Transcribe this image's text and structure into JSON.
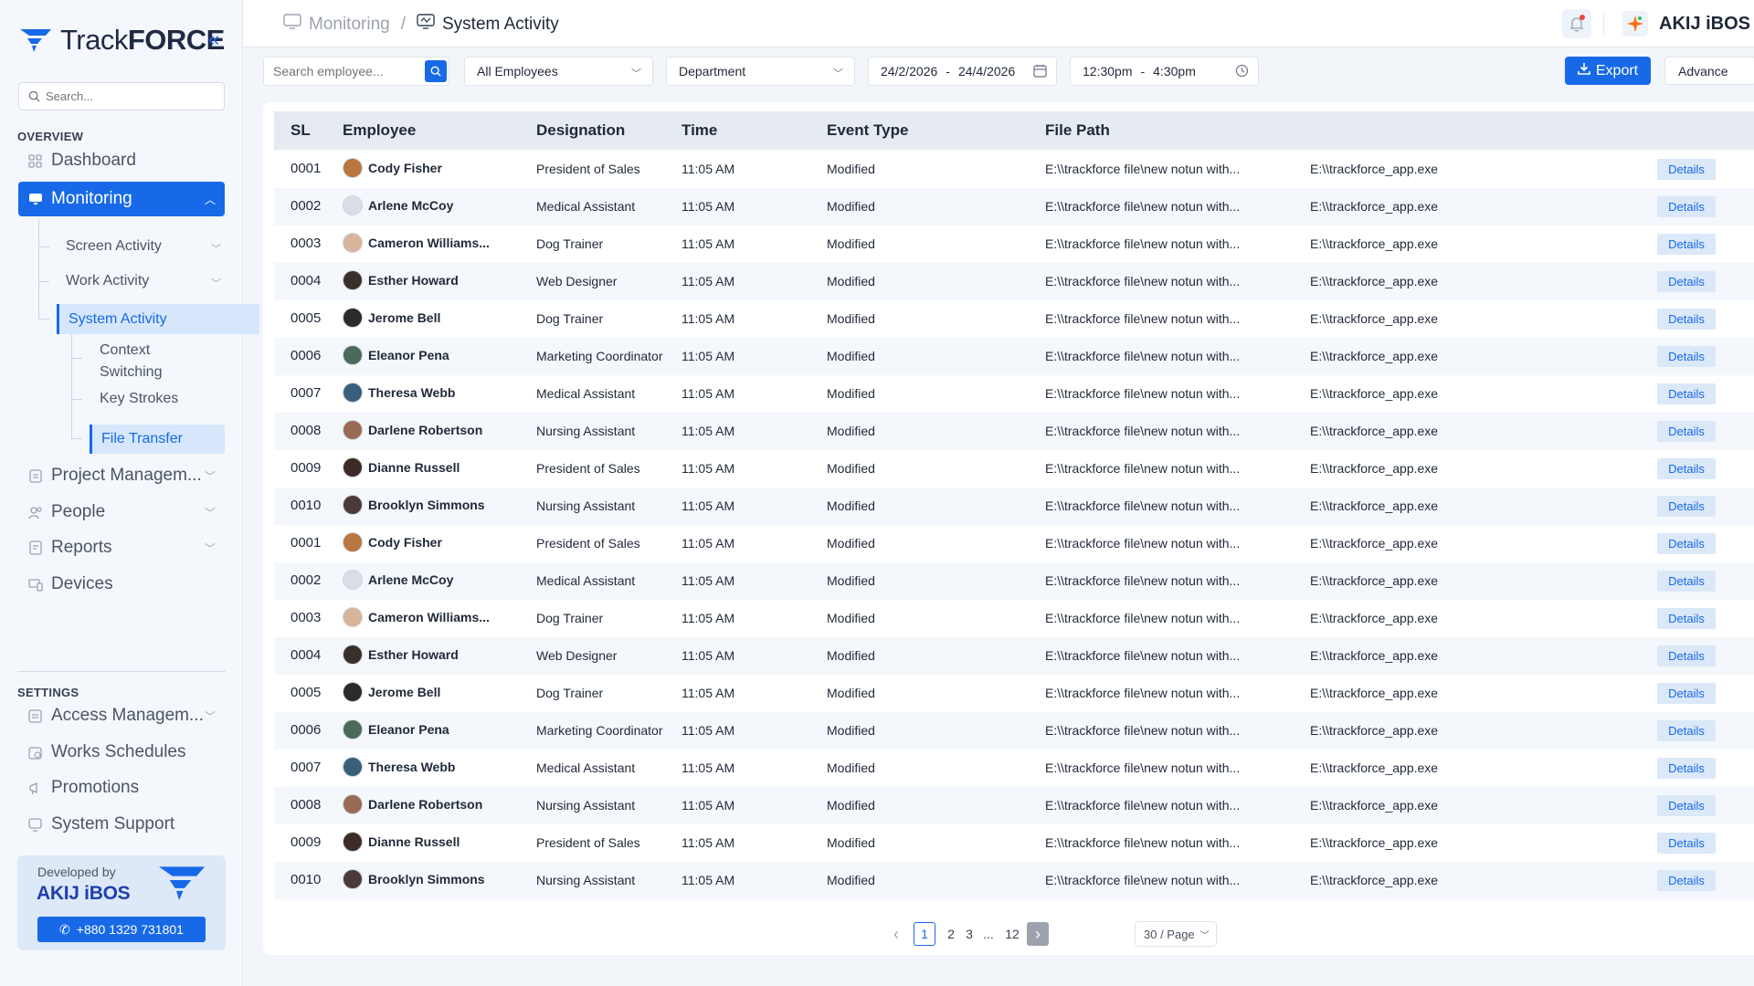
{
  "brand": {
    "name_light": "Track",
    "name_bold": "FORCE"
  },
  "sidebar": {
    "search_placeholder": "Search...",
    "overview_label": "OVERVIEW",
    "settings_label": "SETTINGS",
    "dashboard": "Dashboard",
    "monitoring": "Monitoring",
    "screen_activity": "Screen Activity",
    "work_activity": "Work Activity",
    "system_activity": "System Activity",
    "context_switching_1": "Context",
    "context_switching_2": "Switching",
    "key_strokes": "Key Strokes",
    "file_transfer": "File Transfer",
    "project_management": "Project Managem...",
    "people": "People",
    "reports": "Reports",
    "devices": "Devices",
    "access_management": "Access Managem...",
    "work_schedules": "Works Schedules",
    "promotions": "Promotions",
    "system_support": "System Support",
    "developed_by": "Developed by",
    "developer_brand": "AKIJ iBOS",
    "phone": "+880 1329 731801"
  },
  "header": {
    "crumb_parent": "Monitoring",
    "crumb_separator": "/",
    "crumb_current": "System Activity",
    "company": "AKIJ iBOS"
  },
  "filters": {
    "search_placeholder": "Search employee...",
    "employees": "All Employees",
    "department": "Department",
    "date_from": "24/2/2026",
    "date_to": "24/4/2026",
    "time_from": "12:30pm",
    "time_to": "4:30pm",
    "range_dash": "-",
    "export": "Export",
    "advance": "Advance"
  },
  "table": {
    "headers": {
      "sl": "SL",
      "employee": "Employee",
      "designation": "Designation",
      "time": "Time",
      "event_type": "Event Type",
      "file_path": "File Path"
    },
    "details_label": "Details",
    "rows": [
      {
        "sl": "0001",
        "name": "Cody Fisher",
        "designation": "President of Sales",
        "time": "11:05 AM",
        "event": "Modified",
        "path": "E:\\\\trackforce file\\new notun with...",
        "exe": "E:\\\\trackforce_app.exe",
        "avatar": "#b7773f"
      },
      {
        "sl": "0002",
        "name": "Arlene McCoy",
        "designation": "Medical Assistant",
        "time": "11:05 AM",
        "event": "Modified",
        "path": "E:\\\\trackforce file\\new notun with...",
        "exe": "E:\\\\trackforce_app.exe",
        "avatar": "#d9dde6"
      },
      {
        "sl": "0003",
        "name": "Cameron Williams...",
        "designation": "Dog Trainer",
        "time": "11:05 AM",
        "event": "Modified",
        "path": "E:\\\\trackforce file\\new notun with...",
        "exe": "E:\\\\trackforce_app.exe",
        "avatar": "#d8b49a"
      },
      {
        "sl": "0004",
        "name": "Esther Howard",
        "designation": "Web Designer",
        "time": "11:05 AM",
        "event": "Modified",
        "path": "E:\\\\trackforce file\\new notun with...",
        "exe": "E:\\\\trackforce_app.exe",
        "avatar": "#3b2f2a"
      },
      {
        "sl": "0005",
        "name": "Jerome Bell",
        "designation": "Dog Trainer",
        "time": "11:05 AM",
        "event": "Modified",
        "path": "E:\\\\trackforce file\\new notun with...",
        "exe": "E:\\\\trackforce_app.exe",
        "avatar": "#2b2b2b"
      },
      {
        "sl": "0006",
        "name": "Eleanor Pena",
        "designation": "Marketing Coordinator",
        "time": "11:05 AM",
        "event": "Modified",
        "path": "E:\\\\trackforce file\\new notun with...",
        "exe": "E:\\\\trackforce_app.exe",
        "avatar": "#4b6a5a"
      },
      {
        "sl": "0007",
        "name": "Theresa Webb",
        "designation": "Medical Assistant",
        "time": "11:05 AM",
        "event": "Modified",
        "path": "E:\\\\trackforce file\\new notun with...",
        "exe": "E:\\\\trackforce_app.exe",
        "avatar": "#3a5f7a"
      },
      {
        "sl": "0008",
        "name": "Darlene Robertson",
        "designation": "Nursing Assistant",
        "time": "11:05 AM",
        "event": "Modified",
        "path": "E:\\\\trackforce file\\new notun with...",
        "exe": "E:\\\\trackforce_app.exe",
        "avatar": "#9a6a55"
      },
      {
        "sl": "0009",
        "name": "Dianne Russell",
        "designation": "President of Sales",
        "time": "11:05 AM",
        "event": "Modified",
        "path": "E:\\\\trackforce file\\new notun with...",
        "exe": "E:\\\\trackforce_app.exe",
        "avatar": "#3d2b25"
      },
      {
        "sl": "0010",
        "name": "Brooklyn Simmons",
        "designation": "Nursing Assistant",
        "time": "11:05 AM",
        "event": "Modified",
        "path": "E:\\\\trackforce file\\new notun with...",
        "exe": "E:\\\\trackforce_app.exe",
        "avatar": "#4a3a3a"
      },
      {
        "sl": "0001",
        "name": "Cody Fisher",
        "designation": "President of Sales",
        "time": "11:05 AM",
        "event": "Modified",
        "path": "E:\\\\trackforce file\\new notun with...",
        "exe": "E:\\\\trackforce_app.exe",
        "avatar": "#b7773f"
      },
      {
        "sl": "0002",
        "name": "Arlene McCoy",
        "designation": "Medical Assistant",
        "time": "11:05 AM",
        "event": "Modified",
        "path": "E:\\\\trackforce file\\new notun with...",
        "exe": "E:\\\\trackforce_app.exe",
        "avatar": "#d9dde6"
      },
      {
        "sl": "0003",
        "name": "Cameron Williams...",
        "designation": "Dog Trainer",
        "time": "11:05 AM",
        "event": "Modified",
        "path": "E:\\\\trackforce file\\new notun with...",
        "exe": "E:\\\\trackforce_app.exe",
        "avatar": "#d8b49a"
      },
      {
        "sl": "0004",
        "name": "Esther Howard",
        "designation": "Web Designer",
        "time": "11:05 AM",
        "event": "Modified",
        "path": "E:\\\\trackforce file\\new notun with...",
        "exe": "E:\\\\trackforce_app.exe",
        "avatar": "#3b2f2a"
      },
      {
        "sl": "0005",
        "name": "Jerome Bell",
        "designation": "Dog Trainer",
        "time": "11:05 AM",
        "event": "Modified",
        "path": "E:\\\\trackforce file\\new notun with...",
        "exe": "E:\\\\trackforce_app.exe",
        "avatar": "#2b2b2b"
      },
      {
        "sl": "0006",
        "name": "Eleanor Pena",
        "designation": "Marketing Coordinator",
        "time": "11:05 AM",
        "event": "Modified",
        "path": "E:\\\\trackforce file\\new notun with...",
        "exe": "E:\\\\trackforce_app.exe",
        "avatar": "#4b6a5a"
      },
      {
        "sl": "0007",
        "name": "Theresa Webb",
        "designation": "Medical Assistant",
        "time": "11:05 AM",
        "event": "Modified",
        "path": "E:\\\\trackforce file\\new notun with...",
        "exe": "E:\\\\trackforce_app.exe",
        "avatar": "#3a5f7a"
      },
      {
        "sl": "0008",
        "name": "Darlene Robertson",
        "designation": "Nursing Assistant",
        "time": "11:05 AM",
        "event": "Modified",
        "path": "E:\\\\trackforce file\\new notun with...",
        "exe": "E:\\\\trackforce_app.exe",
        "avatar": "#9a6a55"
      },
      {
        "sl": "0009",
        "name": "Dianne Russell",
        "designation": "President of Sales",
        "time": "11:05 AM",
        "event": "Modified",
        "path": "E:\\\\trackforce file\\new notun with...",
        "exe": "E:\\\\trackforce_app.exe",
        "avatar": "#3d2b25"
      },
      {
        "sl": "0010",
        "name": "Brooklyn Simmons",
        "designation": "Nursing Assistant",
        "time": "11:05 AM",
        "event": "Modified",
        "path": "E:\\\\trackforce file\\new notun with...",
        "exe": "E:\\\\trackforce_app.exe",
        "avatar": "#4a3a3a"
      }
    ]
  },
  "pagination": {
    "prev": "‹",
    "pages": [
      "1",
      "2",
      "3",
      "...",
      "12"
    ],
    "next": "›",
    "per_page": "30 / Page"
  },
  "colors": {
    "accent": "#1769e8",
    "active_bg": "#d7e7fb"
  }
}
